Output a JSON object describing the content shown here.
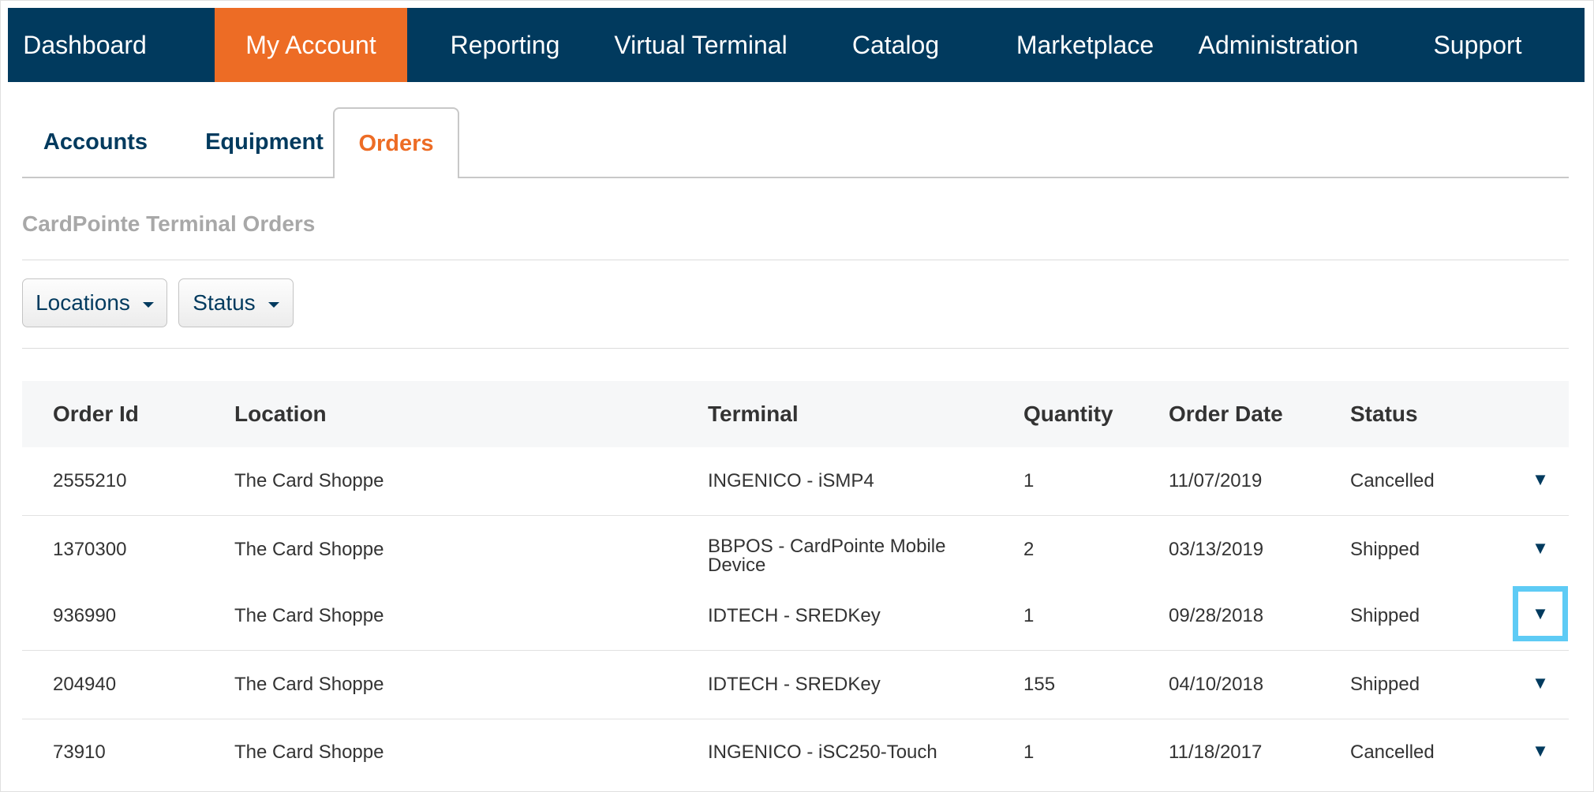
{
  "nav": {
    "items": [
      {
        "label": "Dashboard",
        "active": false
      },
      {
        "label": "My Account",
        "active": true
      },
      {
        "label": "Reporting",
        "active": false
      },
      {
        "label": "Virtual Terminal",
        "active": false
      },
      {
        "label": "Catalog",
        "active": false
      },
      {
        "label": "Marketplace",
        "active": false
      },
      {
        "label": "Administration",
        "active": false
      },
      {
        "label": "Support",
        "active": false
      }
    ]
  },
  "tabs": [
    {
      "label": "Accounts",
      "active": false
    },
    {
      "label": "Equipment",
      "active": false
    },
    {
      "label": "Orders",
      "active": true
    }
  ],
  "section_title": "CardPointe Terminal Orders",
  "filters": {
    "locations_label": "Locations",
    "status_label": "Status"
  },
  "table": {
    "columns": [
      "Order Id",
      "Location",
      "Terminal",
      "Quantity",
      "Order Date",
      "Status"
    ],
    "rows": [
      {
        "order_id": "2555210",
        "location": "The Card Shoppe",
        "terminal": "INGENICO - iSMP4",
        "quantity": "1",
        "order_date": "11/07/2019",
        "status": "Cancelled"
      },
      {
        "order_id": "1370300",
        "location": "The Card Shoppe",
        "terminal": "BBPOS - CardPointe Mobile Device",
        "quantity": "2",
        "order_date": "03/13/2019",
        "status": "Shipped"
      },
      {
        "order_id": "936990",
        "location": "The Card Shoppe",
        "terminal": "IDTECH - SREDKey",
        "quantity": "1",
        "order_date": "09/28/2018",
        "status": "Shipped"
      },
      {
        "order_id": "204940",
        "location": "The Card Shoppe",
        "terminal": "IDTECH - SREDKey",
        "quantity": "155",
        "order_date": "04/10/2018",
        "status": "Shipped"
      },
      {
        "order_id": "73910",
        "location": "The Card Shoppe",
        "terminal": "INGENICO - iSC250-Touch",
        "quantity": "1",
        "order_date": "11/18/2017",
        "status": "Cancelled"
      }
    ],
    "expand_glyph": "▼",
    "expand_icon": "triangle-down-icon"
  },
  "colors": {
    "nav_bg": "#013a5e",
    "accent": "#ed6c25",
    "highlight": "#5ecbf5"
  }
}
